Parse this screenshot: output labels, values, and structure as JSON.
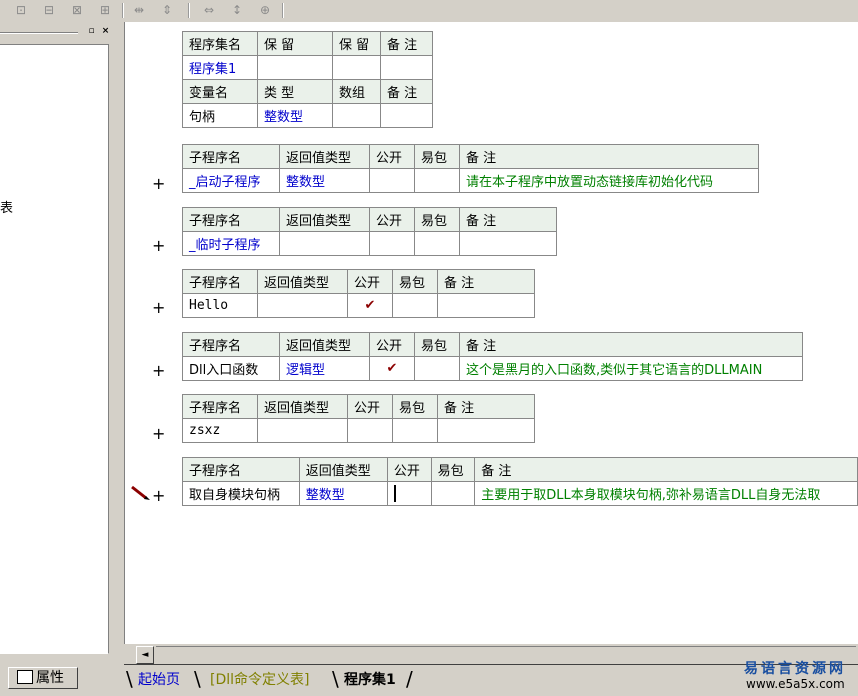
{
  "toolbar": {
    "icons": [
      "align-left-icon",
      "align-center-icon",
      "align-top-icon",
      "align-middle-icon",
      "same-width-icon",
      "same-height-icon",
      "hspace-icon",
      "vspace-icon",
      "center-icon"
    ]
  },
  "left_panel": {
    "minimize_label": "▫",
    "close_label": "×",
    "partial_text": "表",
    "properties_tab": "属性"
  },
  "assembly": {
    "headers": [
      "程序集名",
      "保 留",
      "保 留",
      "备 注"
    ],
    "name": "程序集1",
    "var_headers": [
      "变量名",
      "类 型",
      "数组",
      "备 注"
    ],
    "vars": [
      {
        "name": "句柄",
        "type": "整数型"
      }
    ]
  },
  "subroutine_headers": [
    "子程序名",
    "返回值类型",
    "公开",
    "易包",
    "备 注"
  ],
  "subroutines": [
    {
      "name": "_启动子程序",
      "ret": "整数型",
      "public": "",
      "epkg": "",
      "note": "请在本子程序中放置动态链接库初始化代码"
    },
    {
      "name": "_临时子程序",
      "ret": "",
      "public": "",
      "epkg": "",
      "note": ""
    },
    {
      "name": "Hello",
      "ret": "",
      "public": "✔",
      "epkg": "",
      "note": ""
    },
    {
      "name": "Dll入口函数",
      "ret": "逻辑型",
      "public": "✔",
      "epkg": "",
      "note": "这个是黑月的入口函数,类似于其它语言的DLLMAIN"
    },
    {
      "name": "zsxz",
      "ret": "",
      "public": "",
      "epkg": "",
      "note": ""
    },
    {
      "name": "取自身模块句柄",
      "ret": "整数型",
      "public": "",
      "epkg": "",
      "note": "主要用于取DLL本身取模块句柄,弥补易语言DLL自身无法取"
    }
  ],
  "expand_symbol": "+",
  "tabs": [
    "起始页",
    "[Dll命令定义表]",
    "程序集1"
  ],
  "scroll_left": "◄",
  "watermark": {
    "title": "易语言资源网",
    "url": "www.e5a5x.com"
  }
}
